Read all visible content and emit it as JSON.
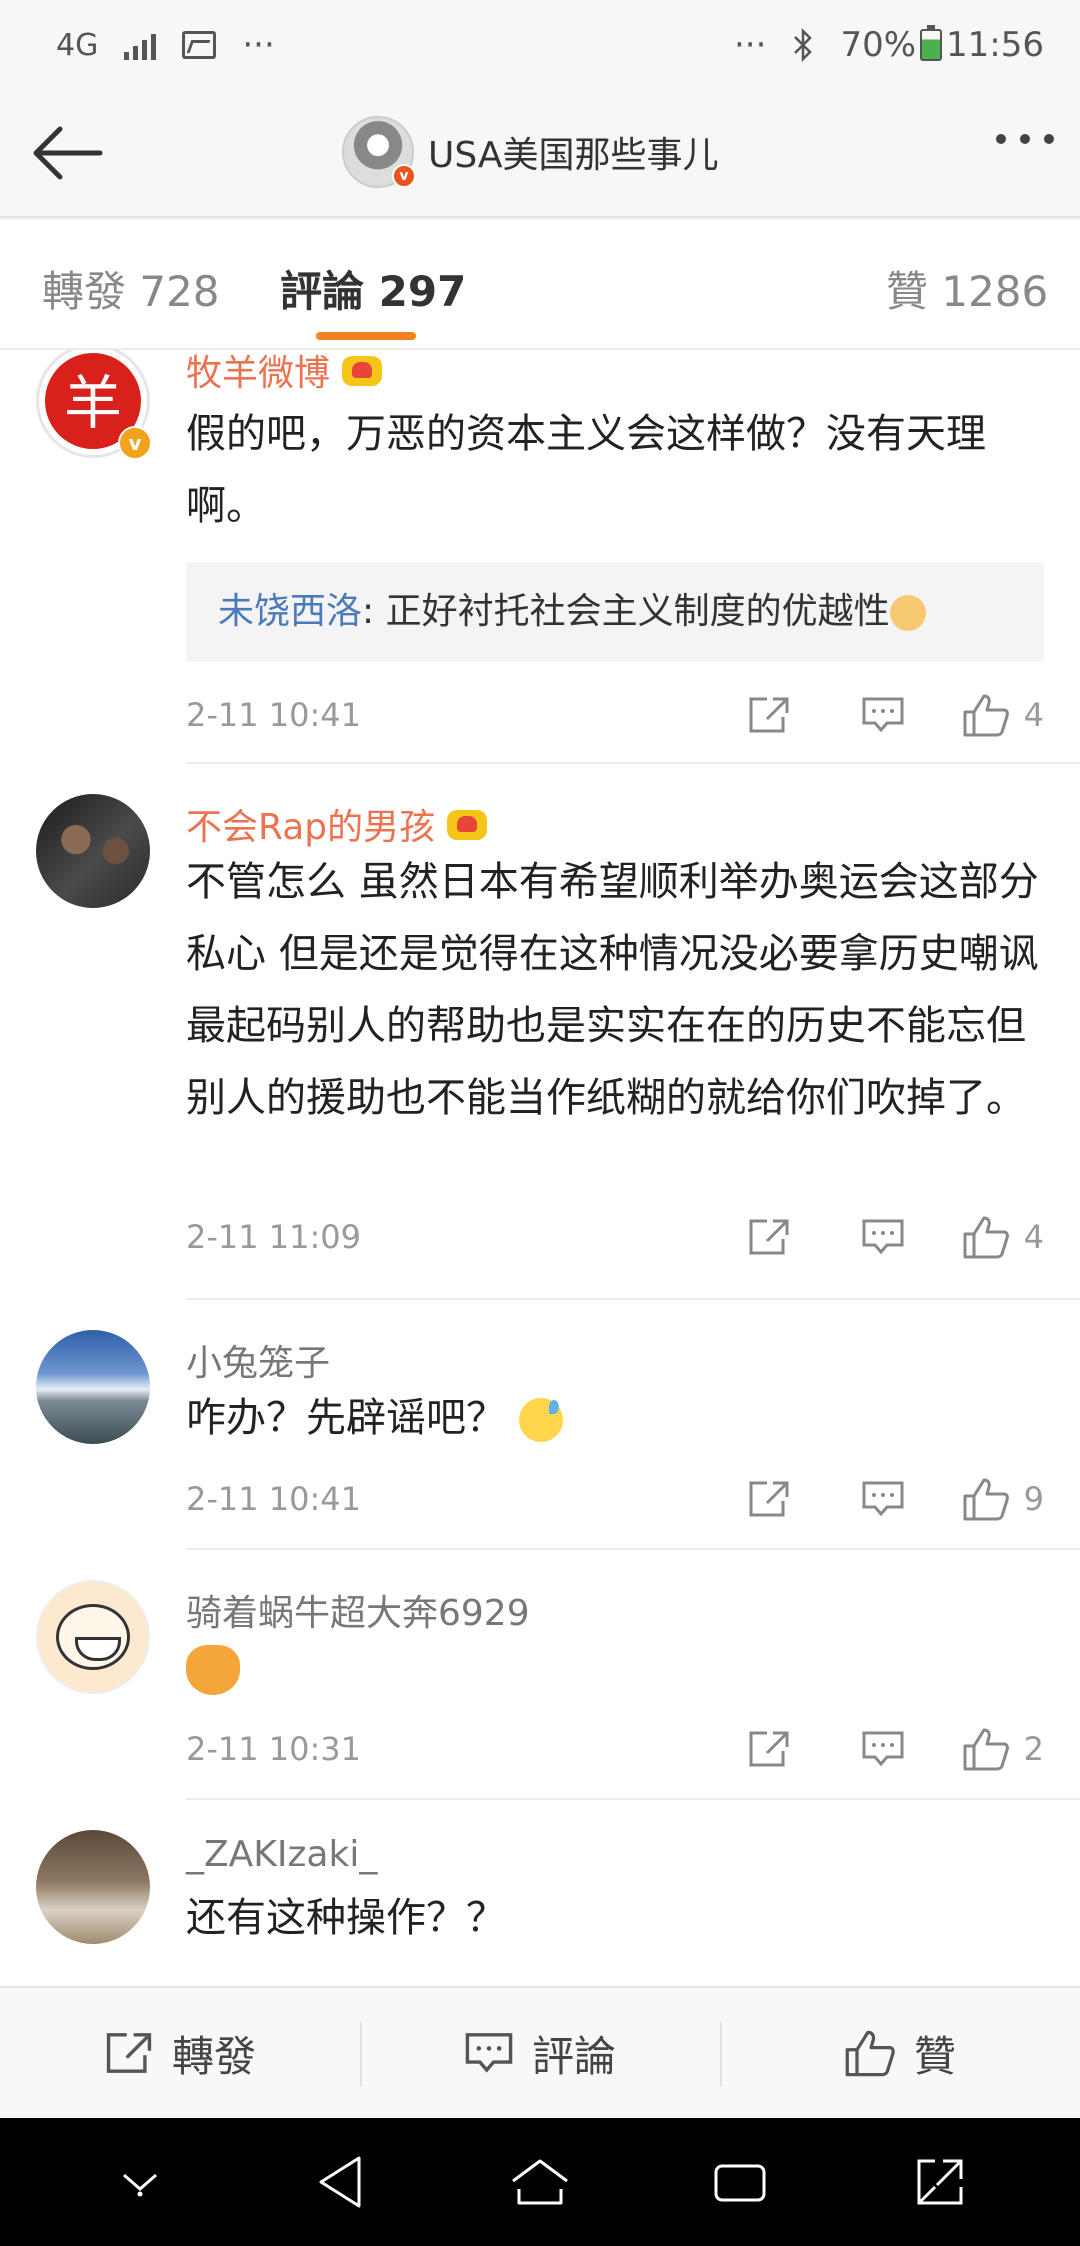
{
  "status_bar": {
    "network": "4G",
    "dots_left": "···",
    "dots_right": "···",
    "battery": "70%",
    "time": "11:56"
  },
  "header": {
    "title": "USA美国那些事儿"
  },
  "tabs": [
    {
      "label": "轉發 728"
    },
    {
      "label": "評論 297"
    },
    {
      "label": "贊 1286"
    }
  ],
  "comments": [
    {
      "author": "牧羊微博",
      "text": "假的吧，万恶的资本主义会这样做？没有天理啊。",
      "reply_user": "未饶西洛",
      "reply_text": ": 正好衬托社会主义制度的优越性",
      "time": "2-11 10:41",
      "likes": "4"
    },
    {
      "author": "不会Rap的男孩",
      "text": "不管怎么 虽然日本有希望顺利举办奥运会这部分私心 但是还是觉得在这种情况没必要拿历史嘲讽 最起码别人的帮助也是实实在在的历史不能忘但别人的援助也不能当作纸糊的就给你们吹掉了。",
      "time": "2-11 11:09",
      "likes": "4"
    },
    {
      "author": "小兔笼子",
      "text": "咋办？先辟谣吧？",
      "time": "2-11 10:41",
      "likes": "9"
    },
    {
      "author": "骑着蜗牛超大奔6929",
      "text": "",
      "time": "2-11 10:31",
      "likes": "2"
    },
    {
      "author": "_ZAKIzaki_",
      "text": "还有这种操作？？"
    }
  ],
  "bottom_bar": {
    "repost": "轉發",
    "comment": "評論",
    "like": "贊"
  },
  "colors": {
    "accent": "#f58220",
    "vip_name": "#eb7350",
    "reply_link": "#4a7ab9"
  }
}
